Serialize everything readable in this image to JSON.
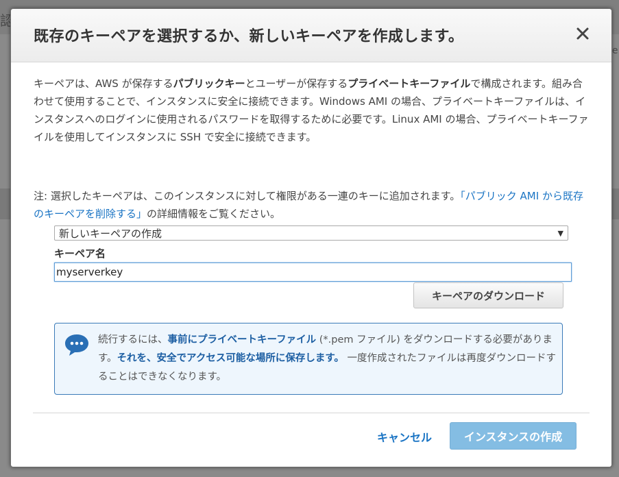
{
  "background": {
    "glyph_left": "認",
    "glyph_right": "le"
  },
  "modal": {
    "title": "既存のキーペアを選択するか、新しいキーペアを作成します。",
    "intro": [
      {
        "text": "キーペアは、AWS が保存する",
        "bold": false
      },
      {
        "text": "パブリックキー",
        "bold": true
      },
      {
        "text": "とユーザーが保存する",
        "bold": false
      },
      {
        "text": "プライベートキーファイル",
        "bold": true
      },
      {
        "text": "で構成されます。組み合わせて使用することで、インスタンスに安全に接続できます。Windows AMI の場合、プライベートキーファイルは、インスタンスへのログインに使用されるパスワードを取得するために必要です。Linux AMI の場合、プライベートキーファイルを使用してインスタンスに SSH で安全に接続できます。",
        "bold": false
      }
    ],
    "note_prefix": "注: 選択したキーペアは、このインスタンスに対して権限がある一連のキーに追加されます。",
    "note_link": "「パブリック AMI から既存のキーペアを削除する」",
    "note_suffix": "の詳細情報をご覧ください。",
    "select_value": "新しいキーペアの作成",
    "select_arrow": "▼",
    "keyname_label": "キーペア名",
    "keyname_value": "myserverkey",
    "download_label": "キーペアのダウンロード",
    "info": {
      "t1": "続行するには、",
      "b1": "事前にプライベートキーファイル",
      "t2": " (*.pem ファイル) をダウンロードする必要があります。",
      "b2": "それを、安全でアクセス可能な場所に保存します。",
      "t3": " 一度作成されたファイルは再度ダウンロードすることはできなくなります。"
    },
    "cancel_label": "キャンセル",
    "create_label": "インスタンスの作成"
  },
  "colors": {
    "link": "#1a74c4",
    "primary_disabled": "#84bde3",
    "info_border": "#3a7ab8"
  }
}
